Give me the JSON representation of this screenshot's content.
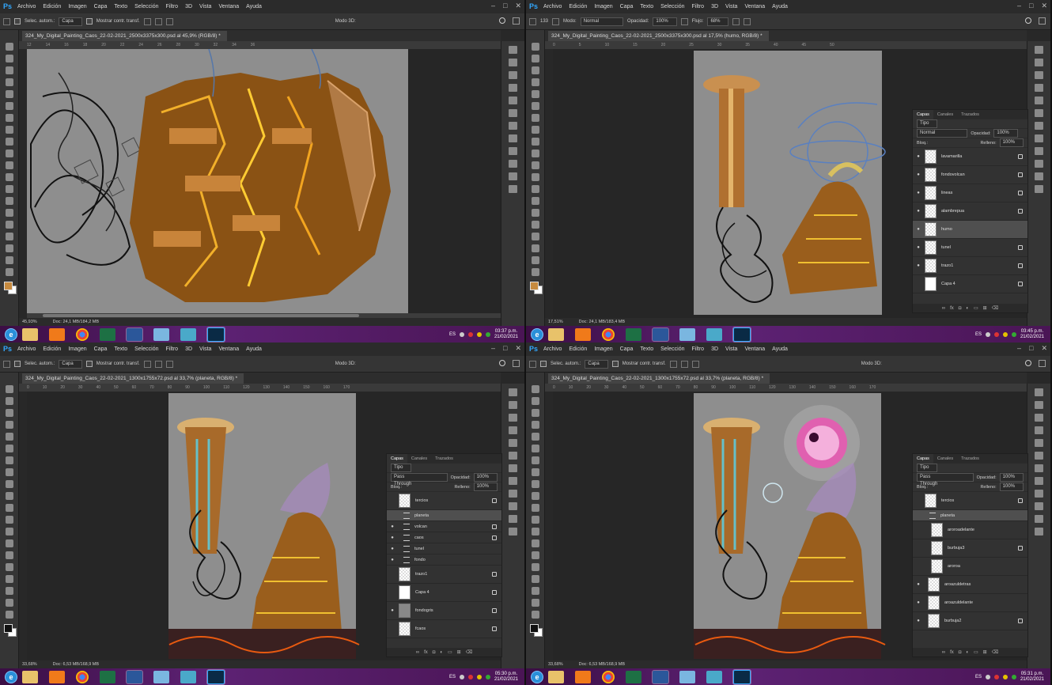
{
  "menu": [
    "Archivo",
    "Edición",
    "Imagen",
    "Capa",
    "Texto",
    "Selección",
    "Filtro",
    "3D",
    "Vista",
    "Ventana",
    "Ayuda"
  ],
  "app_logo": "Ps",
  "window_controls": [
    "–",
    "□",
    "✕"
  ],
  "taskbar_apps": [
    "file-explorer-icon",
    "media-player-icon",
    "chrome-icon",
    "excel-icon",
    "word-icon",
    "notepad-icon",
    "app-icon",
    "photoshop-icon"
  ],
  "tray_lang": "ES",
  "options_move": {
    "auto_select": "Selec. autom.:",
    "target": "Capa",
    "show_transform": "Mostrar contr. transf.",
    "mode3d": "Modo 3D:"
  },
  "options_brush": {
    "size": "133",
    "mode_label": "Modo:",
    "mode": "Normal",
    "opacity_label": "Opacidad:",
    "opacity": "100%",
    "flow_label": "Flujo:",
    "flow": "68%"
  },
  "q1": {
    "tab": "324_My_Digital_Painting_Caos_22-02-2021_2500x3375x300.psd al 45,9% (RGB/8) *",
    "zoom": "45,93%",
    "doc": "Doc: 24,1 MB/184,2 MB",
    "ruler": [
      "12",
      "14",
      "16",
      "18",
      "20",
      "22",
      "24",
      "26",
      "28",
      "30",
      "32",
      "34",
      "36"
    ],
    "time": "03:37 p.m.",
    "date": "21/02/2021"
  },
  "q2": {
    "tab": "324_My_Digital_Painting_Caos_22-02-2021_2500x3375x300.psd al 17,5% (humo, RGB/8) *",
    "zoom": "17,51%",
    "doc": "Doc: 24,1 MB/183,4 MB",
    "ruler": [
      "0",
      "5",
      "10",
      "15",
      "20",
      "25",
      "30",
      "35",
      "40",
      "45",
      "50"
    ],
    "time": "03:45 p.m.",
    "date": "21/02/2021",
    "panel": {
      "tabs": [
        "Capas",
        "Canales",
        "Trazados"
      ],
      "kind": "Tipo",
      "blend": "Normal",
      "opacity_label": "Opacidad:",
      "opacity": "100%",
      "lock_label": "Bloq.:",
      "fill_label": "Relleno:",
      "fill": "100%",
      "layers": [
        "lavamarilla",
        "fondovolcan",
        "lineas",
        "alambrepua",
        "humo",
        "tunel",
        "trazo1",
        "Capa 4"
      ]
    }
  },
  "q3": {
    "tab": "324_My_Digital_Painting_Caos_22-02-2021_1300x1755x72.psd al 33,7% (planeta, RGB/8) *",
    "zoom": "33,68%",
    "doc": "Doc: 6,53 MB/168,9 MB",
    "ruler": [
      "0",
      "10",
      "20",
      "30",
      "40",
      "50",
      "60",
      "70",
      "80",
      "90",
      "100",
      "110",
      "120",
      "130",
      "140",
      "150",
      "160",
      "170"
    ],
    "time": "05:30 p.m.",
    "date": "21/02/2021",
    "panel": {
      "tabs": [
        "Capas",
        "Canales",
        "Trazados"
      ],
      "kind": "Tipo",
      "blend": "Pass Through",
      "opacity_label": "Opacidad:",
      "opacity": "100%",
      "lock_label": "Bloq.:",
      "fill_label": "Relleno:",
      "fill": "100%",
      "layers": [
        "tercios",
        "planeta",
        "volcan",
        "caos",
        "tunel",
        "fondo",
        "trazo1",
        "Capa 4",
        "fondogris",
        "fcaos"
      ]
    }
  },
  "q4": {
    "tab": "324_My_Digital_Painting_Caos_22-02-2021_1300x1755x72.psd al 33,7% (planeta, RGB/8) *",
    "zoom": "33,68%",
    "doc": "Doc: 6,53 MB/168,9 MB",
    "ruler": [
      "0",
      "10",
      "20",
      "30",
      "40",
      "50",
      "60",
      "70",
      "80",
      "90",
      "100",
      "110",
      "120",
      "130",
      "140",
      "150",
      "160",
      "170"
    ],
    "time": "05:31 p.m.",
    "date": "21/02/2021",
    "panel": {
      "tabs": [
        "Capas",
        "Canales",
        "Trazados"
      ],
      "kind": "Tipo",
      "blend": "Pass Through",
      "opacity_label": "Opacidad:",
      "opacity": "100%",
      "lock_label": "Bloq.:",
      "fill_label": "Relleno:",
      "fill": "100%",
      "layers": [
        "tercios",
        "planeta",
        "aroroadelante",
        "burbuja3",
        "aroroa",
        "aroazuldetras",
        "aroazuldelante",
        "burbuja2"
      ]
    }
  },
  "colors": {
    "accent": "#31a8ff",
    "foreground": "#c68a3f",
    "canvas_bg": "#8e8e8e",
    "taskbar": "#5d2274"
  }
}
